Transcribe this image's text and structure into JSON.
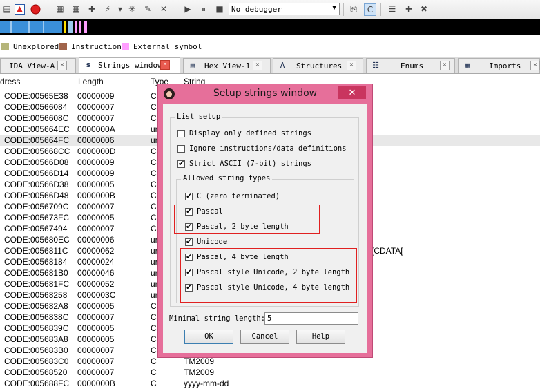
{
  "toolbar": {
    "debugger": "No debugger"
  },
  "legend": [
    {
      "label": "Unexplored",
      "color": "#b5b57a"
    },
    {
      "label": "Instruction",
      "color": "#a0644b"
    },
    {
      "label": "External symbol",
      "color": "#ff9eff"
    }
  ],
  "tabs": [
    {
      "label": "IDA View-A",
      "icon": "graph-icon",
      "active": false
    },
    {
      "label": "Strings window",
      "icon": "strings-icon",
      "active": true
    },
    {
      "label": "Hex View-1",
      "icon": "hex-icon",
      "active": false
    },
    {
      "label": "Structures",
      "icon": "structures-icon",
      "active": false
    },
    {
      "label": "Enums",
      "icon": "enums-icon",
      "active": false
    },
    {
      "label": "Imports",
      "icon": "imports-icon",
      "active": false
    }
  ],
  "table": {
    "columns": [
      "dress",
      "Length",
      "Type",
      "String"
    ],
    "rows": [
      {
        "address": "CODE:00565E38",
        "length": "00000009",
        "type": "C",
        "string": ""
      },
      {
        "address": "CODE:00566084",
        "length": "00000007",
        "type": "C",
        "string": ""
      },
      {
        "address": "CODE:0056608C",
        "length": "00000007",
        "type": "C",
        "string": ""
      },
      {
        "address": "CODE:005664EC",
        "length": "0000000A",
        "type": "ur",
        "string": ""
      },
      {
        "address": "CODE:005664FC",
        "length": "00000006",
        "type": "ur",
        "string": ""
      },
      {
        "address": "CODE:005668CC",
        "length": "0000000D",
        "type": "C",
        "string": ""
      },
      {
        "address": "CODE:00566D08",
        "length": "00000009",
        "type": "C",
        "string": ""
      },
      {
        "address": "CODE:00566D14",
        "length": "00000009",
        "type": "C",
        "string": ""
      },
      {
        "address": "CODE:00566D38",
        "length": "00000005",
        "type": "C",
        "string": ""
      },
      {
        "address": "CODE:00566D48",
        "length": "0000000B",
        "type": "C",
        "string": ""
      },
      {
        "address": "CODE:0056709C",
        "length": "00000007",
        "type": "C",
        "string": ""
      },
      {
        "address": "CODE:005673FC",
        "length": "00000005",
        "type": "C",
        "string": ""
      },
      {
        "address": "CODE:00567494",
        "length": "00000007",
        "type": "C",
        "string": ""
      },
      {
        "address": "CODE:005680EC",
        "length": "00000006",
        "type": "ur",
        "string": ""
      },
      {
        "address": "CODE:0056811C",
        "length": "00000062",
        "type": "ur",
        "string": "[CDATA["
      },
      {
        "address": "CODE:00568184",
        "length": "00000024",
        "type": "ur",
        "string": ""
      },
      {
        "address": "CODE:005681B0",
        "length": "00000046",
        "type": "ur",
        "string": ""
      },
      {
        "address": "CODE:005681FC",
        "length": "00000052",
        "type": "ur",
        "string": ""
      },
      {
        "address": "CODE:00568258",
        "length": "0000003C",
        "type": "ur",
        "string": ""
      },
      {
        "address": "CODE:005682A8",
        "length": "00000005",
        "type": "C",
        "string": ""
      },
      {
        "address": "CODE:0056838C",
        "length": "00000007",
        "type": "C",
        "string": ""
      },
      {
        "address": "CODE:0056839C",
        "length": "00000005",
        "type": "C",
        "string": ""
      },
      {
        "address": "CODE:005683A8",
        "length": "00000005",
        "type": "C",
        "string": ""
      },
      {
        "address": "CODE:005683B0",
        "length": "00000007",
        "type": "C",
        "string": ""
      },
      {
        "address": "CODE:005683C0",
        "length": "00000007",
        "type": "C",
        "string": "TM2009"
      },
      {
        "address": "CODE:00568520",
        "length": "00000007",
        "type": "C",
        "string": "TM2009"
      },
      {
        "address": "CODE:005688FC",
        "length": "0000000B",
        "type": "C",
        "string": "yyyy-mm-dd"
      }
    ]
  },
  "dialog": {
    "title": "Setup strings window",
    "close_label": "✕",
    "list_setup_label": "List setup",
    "options": [
      {
        "label": "Display only defined strings",
        "checked": false
      },
      {
        "label": "Ignore instructions/data definitions",
        "checked": false
      },
      {
        "label": "Strict ASCII (7-bit) strings",
        "checked": true
      }
    ],
    "allowed_types_label": "Allowed string types",
    "types": [
      {
        "label": "C (zero terminated)",
        "checked": true
      },
      {
        "label": "Pascal",
        "checked": true
      },
      {
        "label": "Pascal, 2 byte length",
        "checked": true
      },
      {
        "label": "Unicode",
        "checked": true
      },
      {
        "label": "Pascal, 4 byte length",
        "checked": true
      },
      {
        "label": "Pascal style Unicode, 2 byte length",
        "checked": true
      },
      {
        "label": "Pascal style Unicode, 4 byte length",
        "checked": true
      }
    ],
    "min_length_label": "Minimal string length:",
    "min_length_value": "5",
    "buttons": {
      "ok": "OK",
      "cancel": "Cancel",
      "help": "Help"
    },
    "highlight_color": "#e02020"
  }
}
